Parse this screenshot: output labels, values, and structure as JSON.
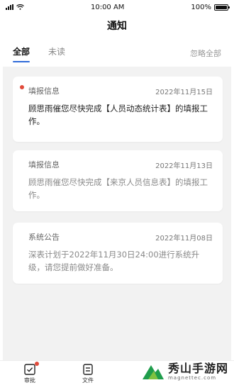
{
  "status": {
    "time": "10:00 AM",
    "battery": "100%"
  },
  "header": {
    "title": "通知"
  },
  "tabs": [
    {
      "label": "全部",
      "active": true
    },
    {
      "label": "未读",
      "active": false
    }
  ],
  "ignore_all": "忽略全部",
  "notifications": [
    {
      "type": "填报信息",
      "date": "2022年11月15日",
      "text": "顾思雨催您尽快完成【人员动态统计表】的填报工作。",
      "unread": true
    },
    {
      "type": "填报信息",
      "date": "2022年11月13日",
      "text": "顾思雨催您尽快完成【来京人员信息表】的填报工作。",
      "unread": false
    },
    {
      "type": "系统公告",
      "date": "2022年11月08日",
      "text": "深表计划于2022年11月30日24:00进行系统升级，请您提前做好准备。",
      "unread": false
    }
  ],
  "bottom_nav": [
    {
      "label": "审批",
      "icon": "approval-icon",
      "badge": true
    },
    {
      "label": "文件",
      "icon": "file-icon",
      "badge": false
    }
  ],
  "watermark": {
    "title": "秀山手游网",
    "subtitle": "magnettec.com"
  },
  "colors": {
    "accent": "#2f6bd8",
    "badge": "#e14b3b",
    "background": "#f2f2f2"
  }
}
